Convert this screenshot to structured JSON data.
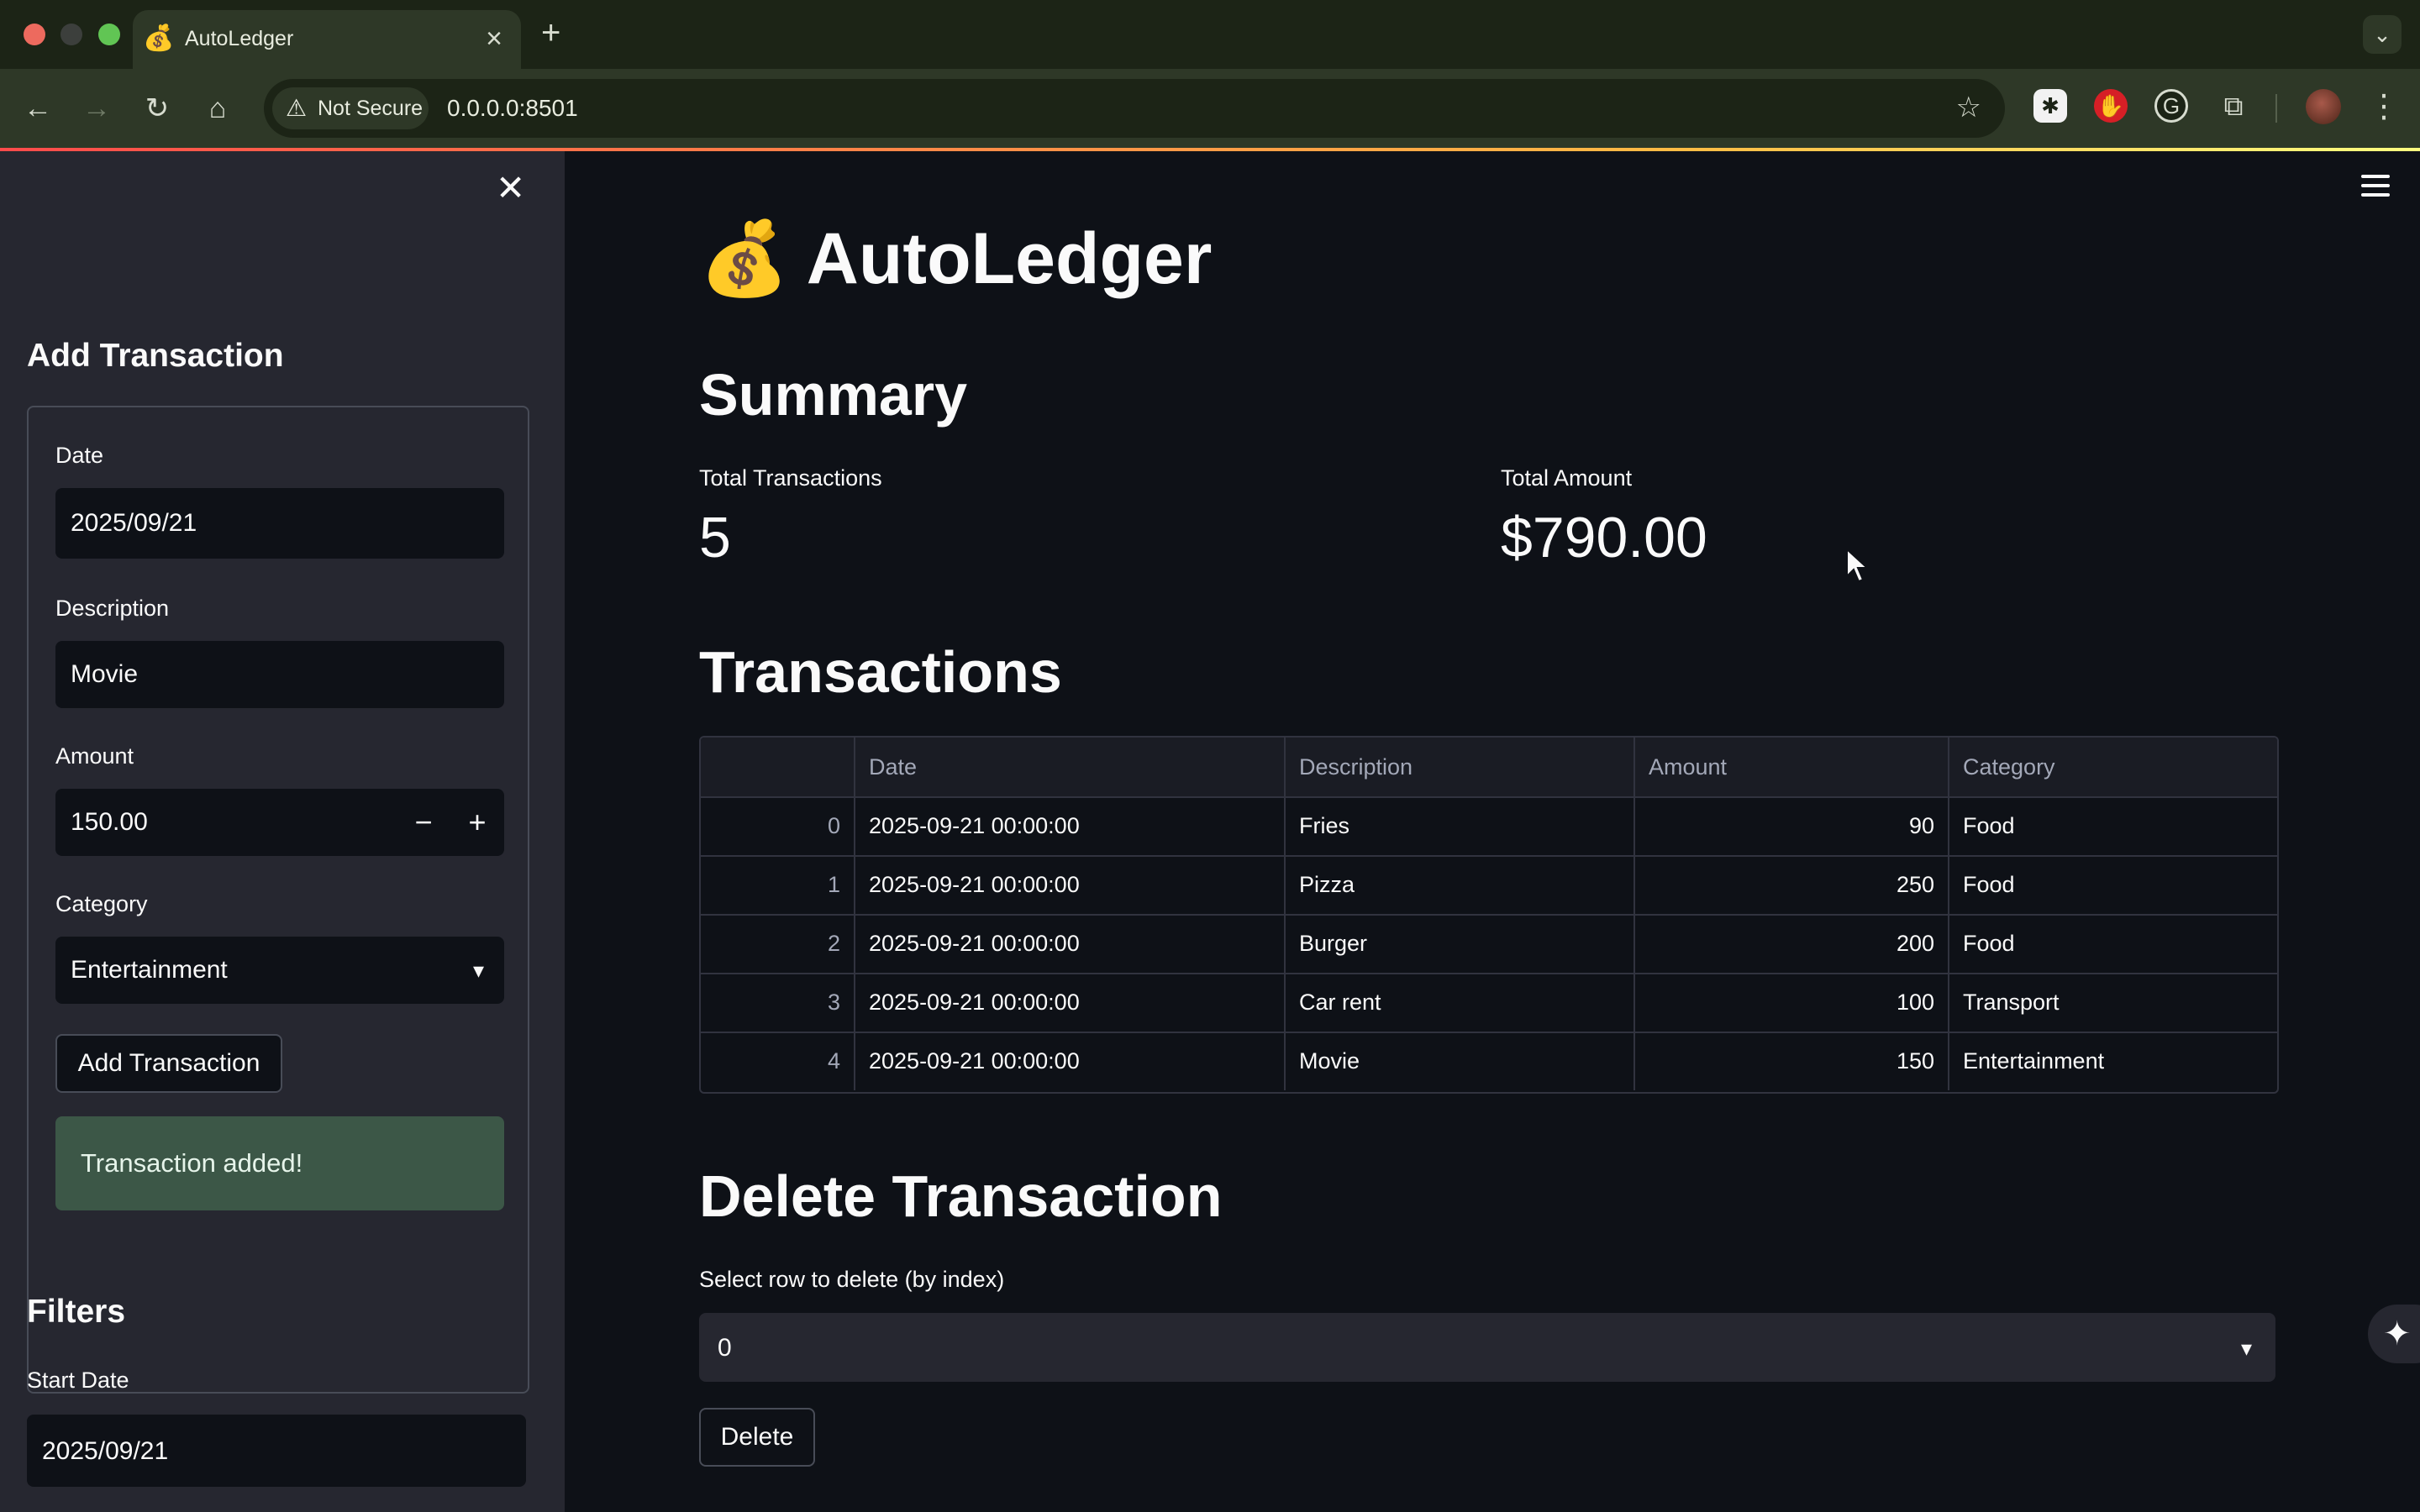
{
  "browser": {
    "tab_title": "AutoLedger",
    "tab_favicon": "💰",
    "security_label": "Not Secure",
    "url": "0.0.0.0:8501"
  },
  "sidebar": {
    "add_header": "Add Transaction",
    "date_label": "Date",
    "date_value": "2025/09/21",
    "description_label": "Description",
    "description_value": "Movie",
    "amount_label": "Amount",
    "amount_value": "150.00",
    "category_label": "Category",
    "category_value": "Entertainment",
    "add_button": "Add Transaction",
    "success_message": "Transaction added!",
    "filters_header": "Filters",
    "start_date_label": "Start Date",
    "start_date_value": "2025/09/21"
  },
  "main": {
    "title_icon": "💰",
    "title": "AutoLedger",
    "summary_header": "Summary",
    "metrics": {
      "total_transactions_label": "Total Transactions",
      "total_transactions_value": "5",
      "total_amount_label": "Total Amount",
      "total_amount_value": "$790.00"
    },
    "transactions_header": "Transactions",
    "table": {
      "columns": [
        "",
        "Date",
        "Description",
        "Amount",
        "Category"
      ],
      "rows": [
        [
          "0",
          "2025-09-21 00:00:00",
          "Fries",
          "90",
          "Food"
        ],
        [
          "1",
          "2025-09-21 00:00:00",
          "Pizza",
          "250",
          "Food"
        ],
        [
          "2",
          "2025-09-21 00:00:00",
          "Burger",
          "200",
          "Food"
        ],
        [
          "3",
          "2025-09-21 00:00:00",
          "Car rent",
          "100",
          "Transport"
        ],
        [
          "4",
          "2025-09-21 00:00:00",
          "Movie",
          "150",
          "Entertainment"
        ]
      ]
    },
    "delete_header": "Delete Transaction",
    "delete_select_label": "Select row to delete (by index)",
    "delete_select_value": "0",
    "delete_button": "Delete"
  }
}
